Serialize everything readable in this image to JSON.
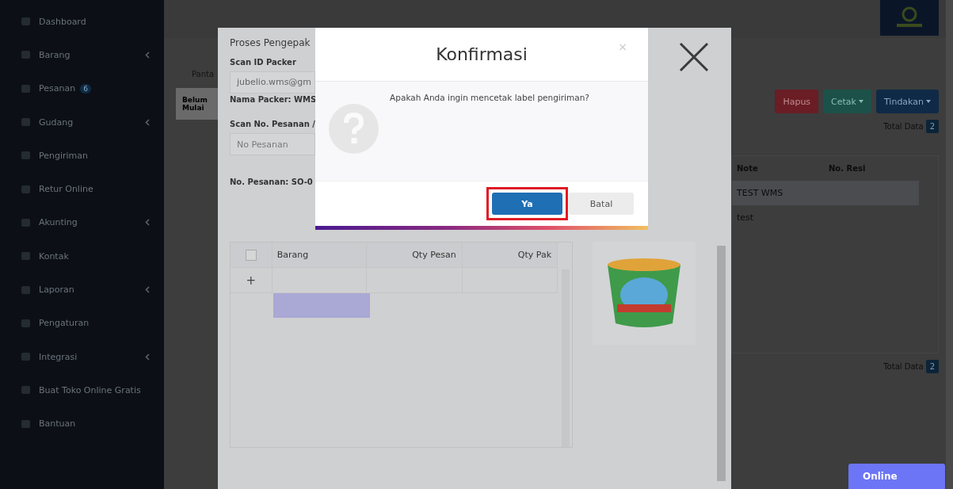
{
  "sidebar": {
    "items": [
      {
        "label": "Dashboard",
        "has_submenu": false
      },
      {
        "label": "Barang",
        "has_submenu": true
      },
      {
        "label": "Pesanan",
        "has_submenu": false,
        "badge": "6"
      },
      {
        "label": "Gudang",
        "has_submenu": true
      },
      {
        "label": "Pengiriman",
        "has_submenu": false
      },
      {
        "label": "Retur Online",
        "has_submenu": false
      },
      {
        "label": "Akunting",
        "has_submenu": true
      },
      {
        "label": "Kontak",
        "has_submenu": false
      },
      {
        "label": "Laporan",
        "has_submenu": true
      },
      {
        "label": "Pengaturan",
        "has_submenu": false
      },
      {
        "label": "Integrasi",
        "has_submenu": true
      },
      {
        "label": "Buat Toko Online Gratis",
        "has_submenu": false
      },
      {
        "label": "Bantuan",
        "has_submenu": false
      }
    ]
  },
  "background_page": {
    "tab_label": "Panta",
    "status_label": "Belum Mulai",
    "actions": [
      {
        "label": "Hapus",
        "kind": "danger",
        "caret": false
      },
      {
        "label": "Cetak",
        "kind": "success",
        "caret": true
      },
      {
        "label": "Tindakan",
        "kind": "primary",
        "caret": true
      }
    ],
    "total_top": {
      "label": "Total Data",
      "count": "2"
    },
    "table": {
      "columns": [
        "Note",
        "No. Resi"
      ],
      "rows": [
        {
          "cells": [
            "TEST WMS",
            ""
          ],
          "selected": true
        },
        {
          "cells": [
            "test",
            ""
          ],
          "selected": false
        }
      ]
    },
    "total_bottom": {
      "label": "Total Data",
      "count": "2"
    }
  },
  "packing_modal": {
    "title": "Proses Pengepak",
    "packer_label": "Scan ID Packer",
    "packer_value": "jubelio.wms@gm",
    "packer_name": "Nama Packer: WMS",
    "order_label": "Scan No. Pesanan /",
    "order_placeholder": "No Pesanan",
    "order_number": "No. Pesanan: SO-0",
    "table": {
      "select_all_checked": false,
      "columns": [
        "Barang",
        "Qty Pesan",
        "Qty Pak"
      ],
      "add_symbol": "+"
    }
  },
  "confirm_dialog": {
    "title": "Konfirmasi",
    "close_symbol": "×",
    "message": "Apakah Anda ingin mencetak label pengiriman?",
    "buttons": [
      {
        "label": "Ya",
        "kind": "primary",
        "highlighted": true
      },
      {
        "label": "Batal",
        "kind": "default",
        "highlighted": false
      }
    ]
  },
  "chat_button": {
    "label": "Online"
  }
}
